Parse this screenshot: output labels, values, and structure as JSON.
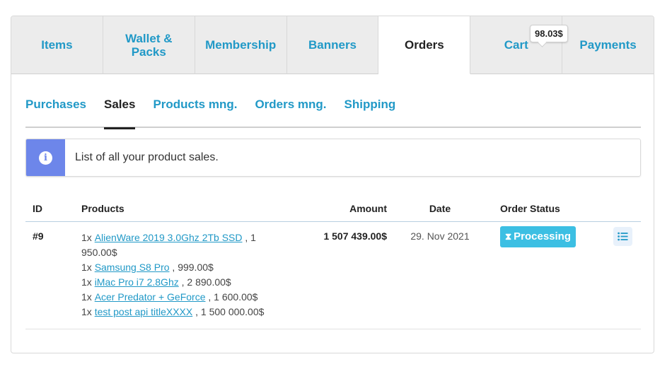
{
  "main_tabs": [
    {
      "label": "Items"
    },
    {
      "label": "Wallet & Packs"
    },
    {
      "label": "Membership"
    },
    {
      "label": "Banners"
    },
    {
      "label": "Orders"
    },
    {
      "label": "Cart"
    },
    {
      "label": "Payments"
    }
  ],
  "cart_badge": "98.03$",
  "sub_tabs": [
    {
      "label": "Purchases"
    },
    {
      "label": "Sales"
    },
    {
      "label": "Products mng."
    },
    {
      "label": "Orders mng."
    },
    {
      "label": "Shipping"
    }
  ],
  "alert": {
    "icon": "info-icon",
    "text": "List of all your product sales."
  },
  "table": {
    "headers": {
      "id": "ID",
      "products": "Products",
      "amount": "Amount",
      "date": "Date",
      "status": "Order Status"
    },
    "rows": [
      {
        "id": "#9",
        "products": [
          {
            "qty": "1x",
            "name": "AlienWare 2019 3.0Ghz 2Tb SSD",
            "price": ", 1 950.00$"
          },
          {
            "qty": "1x",
            "name": "Samsung S8 Pro",
            "price": ", 999.00$"
          },
          {
            "qty": "1x",
            "name": "iMac Pro i7 2.8Ghz",
            "price": ", 2 890.00$"
          },
          {
            "qty": "1x",
            "name": "Acer Predator + GeForce",
            "price": ", 1 600.00$"
          },
          {
            "qty": "1x",
            "name": "test post api titleXXXX",
            "price": ", 1 500 000.00$"
          }
        ],
        "amount": "1 507 439.00$",
        "date": "29. Nov 2021",
        "status": "Processing",
        "status_icon": "hourglass-icon",
        "action_icon": "list-icon"
      }
    ]
  },
  "colors": {
    "link": "#2199c7",
    "info_accent": "#6d86ea",
    "status_processing": "#3cbfe3"
  }
}
